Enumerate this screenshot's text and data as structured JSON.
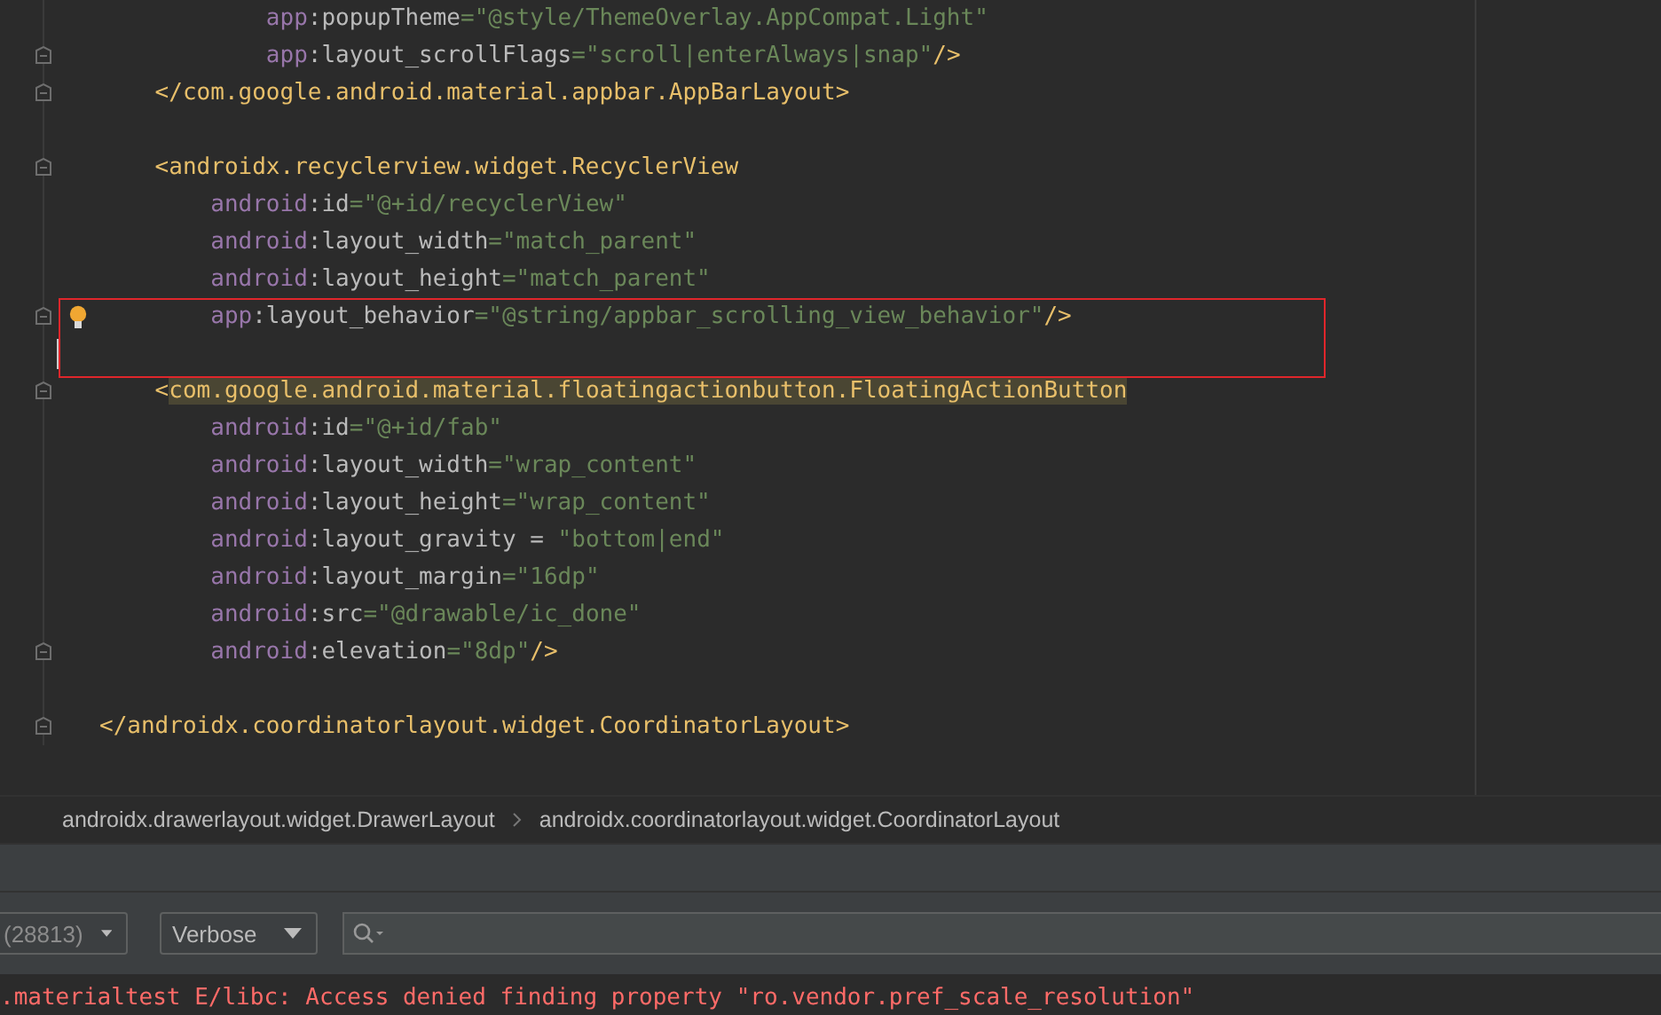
{
  "editor": {
    "lines": [
      {
        "fold": false,
        "bulb": false,
        "caret": false,
        "tokens": [
          {
            "kind": "ns",
            "text": "            app"
          },
          {
            "kind": "plain",
            "text": ":popupTheme"
          },
          {
            "kind": "str",
            "text": "=\"@style/ThemeOverlay.AppCompat.Light\""
          }
        ]
      },
      {
        "fold": true,
        "bulb": false,
        "caret": false,
        "tokens": [
          {
            "kind": "ns",
            "text": "            app"
          },
          {
            "kind": "plain",
            "text": ":layout_scrollFlags"
          },
          {
            "kind": "str",
            "text": "=\"scroll|enterAlways|snap\""
          },
          {
            "kind": "tag",
            "text": "/>"
          }
        ]
      },
      {
        "fold": true,
        "bulb": false,
        "caret": false,
        "tokens": [
          {
            "kind": "tag",
            "text": "    </com.google.android.material.appbar.AppBarLayout>"
          }
        ]
      },
      {
        "fold": false,
        "bulb": false,
        "caret": false
      },
      {
        "fold": true,
        "bulb": false,
        "caret": false,
        "tokens": [
          {
            "kind": "tag",
            "text": "    <androidx.recyclerview.widget.RecyclerView"
          }
        ]
      },
      {
        "fold": false,
        "bulb": false,
        "caret": false,
        "tokens": [
          {
            "kind": "ns",
            "text": "        android"
          },
          {
            "kind": "plain",
            "text": ":id"
          },
          {
            "kind": "str",
            "text": "=\"@+id/recyclerView\""
          }
        ]
      },
      {
        "fold": false,
        "bulb": false,
        "caret": false,
        "tokens": [
          {
            "kind": "ns",
            "text": "        android"
          },
          {
            "kind": "plain",
            "text": ":layout_width"
          },
          {
            "kind": "str",
            "text": "=\"match_parent\""
          }
        ]
      },
      {
        "fold": false,
        "bulb": false,
        "caret": false,
        "tokens": [
          {
            "kind": "ns",
            "text": "        android"
          },
          {
            "kind": "plain",
            "text": ":layout_height"
          },
          {
            "kind": "str",
            "text": "=\"match_parent\""
          }
        ]
      },
      {
        "fold": true,
        "bulb": true,
        "caret": false,
        "tokens": [
          {
            "kind": "ns",
            "text": "        app"
          },
          {
            "kind": "plain",
            "text": ":layout_behavior"
          },
          {
            "kind": "str",
            "text": "=\"@string/appbar_scrolling_view_behavior\""
          },
          {
            "kind": "tag",
            "text": "/>"
          }
        ]
      },
      {
        "fold": false,
        "bulb": false,
        "caret": true
      },
      {
        "fold": true,
        "bulb": false,
        "caret": false,
        "tokens": [
          {
            "kind": "tag",
            "text": "    <"
          },
          {
            "kind": "match",
            "text": "com.google.android.material.floatingactionbutton.FloatingActionButton"
          }
        ]
      },
      {
        "fold": false,
        "bulb": false,
        "caret": false,
        "tokens": [
          {
            "kind": "ns",
            "text": "        android"
          },
          {
            "kind": "plain",
            "text": ":id"
          },
          {
            "kind": "str",
            "text": "=\"@+id/fab\""
          }
        ]
      },
      {
        "fold": false,
        "bulb": false,
        "caret": false,
        "tokens": [
          {
            "kind": "ns",
            "text": "        android"
          },
          {
            "kind": "plain",
            "text": ":layout_width"
          },
          {
            "kind": "str",
            "text": "=\"wrap_content\""
          }
        ]
      },
      {
        "fold": false,
        "bulb": false,
        "caret": false,
        "tokens": [
          {
            "kind": "ns",
            "text": "        android"
          },
          {
            "kind": "plain",
            "text": ":layout_height"
          },
          {
            "kind": "str",
            "text": "=\"wrap_content\""
          }
        ]
      },
      {
        "fold": false,
        "bulb": false,
        "caret": false,
        "tokens": [
          {
            "kind": "ns",
            "text": "        android"
          },
          {
            "kind": "plain",
            "text": ":layout_gravity = "
          },
          {
            "kind": "str",
            "text": "\"bottom|end\""
          }
        ]
      },
      {
        "fold": false,
        "bulb": false,
        "caret": false,
        "tokens": [
          {
            "kind": "ns",
            "text": "        android"
          },
          {
            "kind": "plain",
            "text": ":layout_margin"
          },
          {
            "kind": "str",
            "text": "=\"16dp\""
          }
        ]
      },
      {
        "fold": false,
        "bulb": false,
        "caret": false,
        "tokens": [
          {
            "kind": "ns",
            "text": "        android"
          },
          {
            "kind": "plain",
            "text": ":src"
          },
          {
            "kind": "str",
            "text": "=\"@drawable/ic_done\""
          }
        ]
      },
      {
        "fold": true,
        "bulb": false,
        "caret": false,
        "tokens": [
          {
            "kind": "ns",
            "text": "        android"
          },
          {
            "kind": "plain",
            "text": ":elevation"
          },
          {
            "kind": "str",
            "text": "=\"8dp\""
          },
          {
            "kind": "tag",
            "text": "/>"
          }
        ]
      },
      {
        "fold": false,
        "bulb": false,
        "caret": false
      },
      {
        "fold": true,
        "bulb": false,
        "caret": false,
        "tokens": [
          {
            "kind": "tag",
            "text": "</androidx.coordinatorlayout.widget.CoordinatorLayout>"
          }
        ]
      }
    ]
  },
  "breadcrumbs": [
    "androidx.drawerlayout.widget.DrawerLayout",
    "androidx.coordinatorlayout.widget.CoordinatorLayout"
  ],
  "logcat": {
    "process": "(28813)",
    "level": "Verbose",
    "lines": [
      {
        "text": ".materialtest E/libc: Access denied finding property \"ro.vendor.pref_scale_resolution\""
      }
    ]
  }
}
